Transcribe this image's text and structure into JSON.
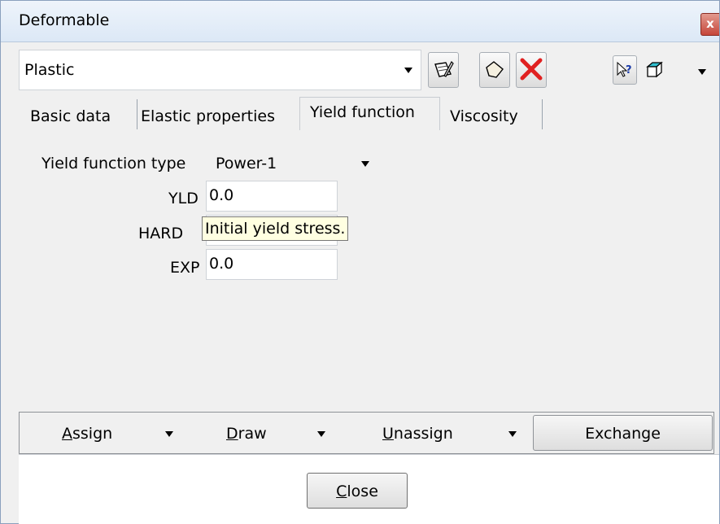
{
  "window": {
    "title": "Deformable",
    "close_glyph": "x"
  },
  "toolbar": {
    "combo_value": "Plastic",
    "icons": [
      "edit-pencil-icon",
      "eraser-icon",
      "delete-x-icon",
      "whats-this-help-icon",
      "3d-box-icon"
    ]
  },
  "tabs": [
    {
      "label": "Basic data"
    },
    {
      "label": "Elastic properties"
    },
    {
      "label": "Yield function"
    },
    {
      "label": "Viscosity"
    }
  ],
  "yield": {
    "type_label": "Yield function type",
    "type_value": "Power-1",
    "fields": [
      {
        "label": "YLD",
        "value": "0.0"
      },
      {
        "label": "HARD",
        "value": ""
      },
      {
        "label": "EXP",
        "value": "0.0"
      }
    ],
    "tooltip": "Initial yield stress."
  },
  "actions": {
    "assign_first": "A",
    "assign_rest": "ssign",
    "draw_first": "D",
    "draw_rest": "raw",
    "unassign_first": "U",
    "unassign_rest": "nassign",
    "exchange": "Exchange"
  },
  "footer": {
    "close_first": "C",
    "close_rest": "lose"
  },
  "colors": {
    "delete_red": "#e02020",
    "tooltip_bg": "#ffffe1",
    "help_blue": "#1a3aa8"
  }
}
